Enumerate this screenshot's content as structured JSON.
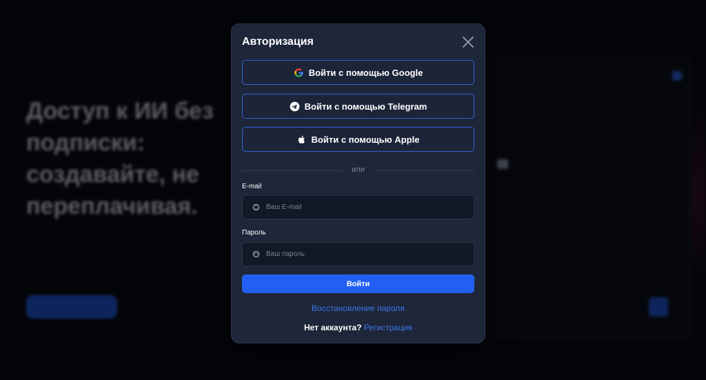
{
  "background": {
    "hero": {
      "title_lines": [
        "Доступ к ИИ без",
        "подписки:",
        "создавайте, не",
        "переплачивая."
      ]
    }
  },
  "modal": {
    "title": "Авторизация",
    "close_icon": "close-icon",
    "oauth": [
      {
        "label": "Войти с помощью Google",
        "icon": "google-icon"
      },
      {
        "label": "Войти с помощью Telegram",
        "icon": "telegram-icon"
      },
      {
        "label": "Войти с помощью Apple",
        "icon": "apple-icon"
      }
    ],
    "divider_text": "или",
    "email": {
      "label": "E-mail",
      "placeholder": "Ваш E-mail",
      "value": "",
      "icon": "email-icon"
    },
    "password": {
      "label": "Пароль",
      "placeholder": "Ваш пароль",
      "value": "",
      "icon": "lock-icon"
    },
    "submit_label": "Войти",
    "recover_label": "Восстановление пароля",
    "no_account_text": "Нет аккаунта?",
    "register_label": "Регистрация"
  },
  "colors": {
    "modal_bg": "#1e2639",
    "accent": "#2160f2",
    "link": "#3c76ee",
    "oauth_border": "#2f64d6",
    "page_bg": "#06070c"
  }
}
